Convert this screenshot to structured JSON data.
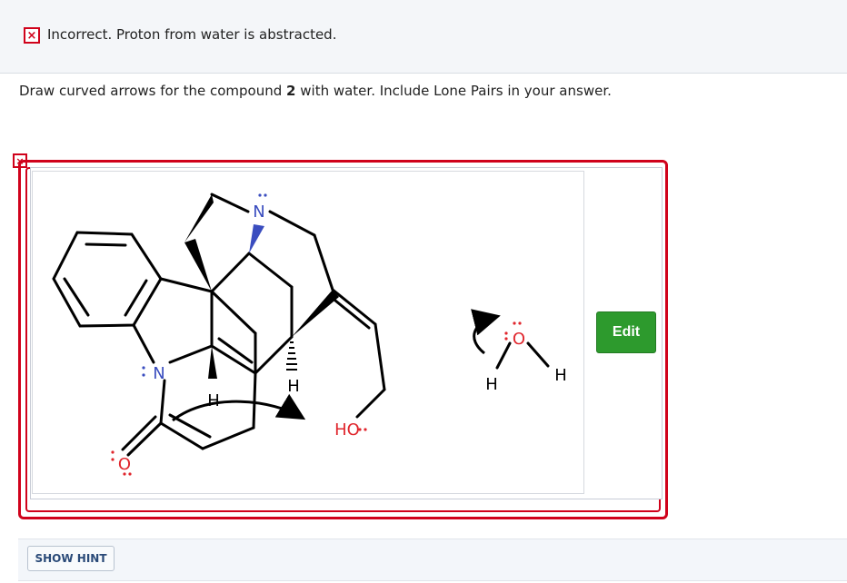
{
  "feedback": {
    "status_icon": "x-icon",
    "text": "Incorrect. Proton from water is abstracted."
  },
  "question": {
    "prefix": "Draw curved arrows for the compound ",
    "compound": "2",
    "suffix": " with water. Include Lone Pairs in your answer."
  },
  "answer": {
    "status_icon": "x-icon",
    "edit_label": "Edit",
    "accent_color": "#d0021b"
  },
  "molecule": {
    "atoms": {
      "n_top": "N",
      "n_indole": "N",
      "o_carbonyl": "O",
      "h1": "H",
      "h2": "H",
      "ho": "HO",
      "water_o": "O",
      "water_h_left": "H",
      "water_h_right": "H"
    },
    "colors": {
      "nitrogen": "#3a4dbf",
      "oxygen": "#e0262d",
      "bond": "#000000"
    }
  },
  "hint": {
    "label": "SHOW HINT"
  }
}
